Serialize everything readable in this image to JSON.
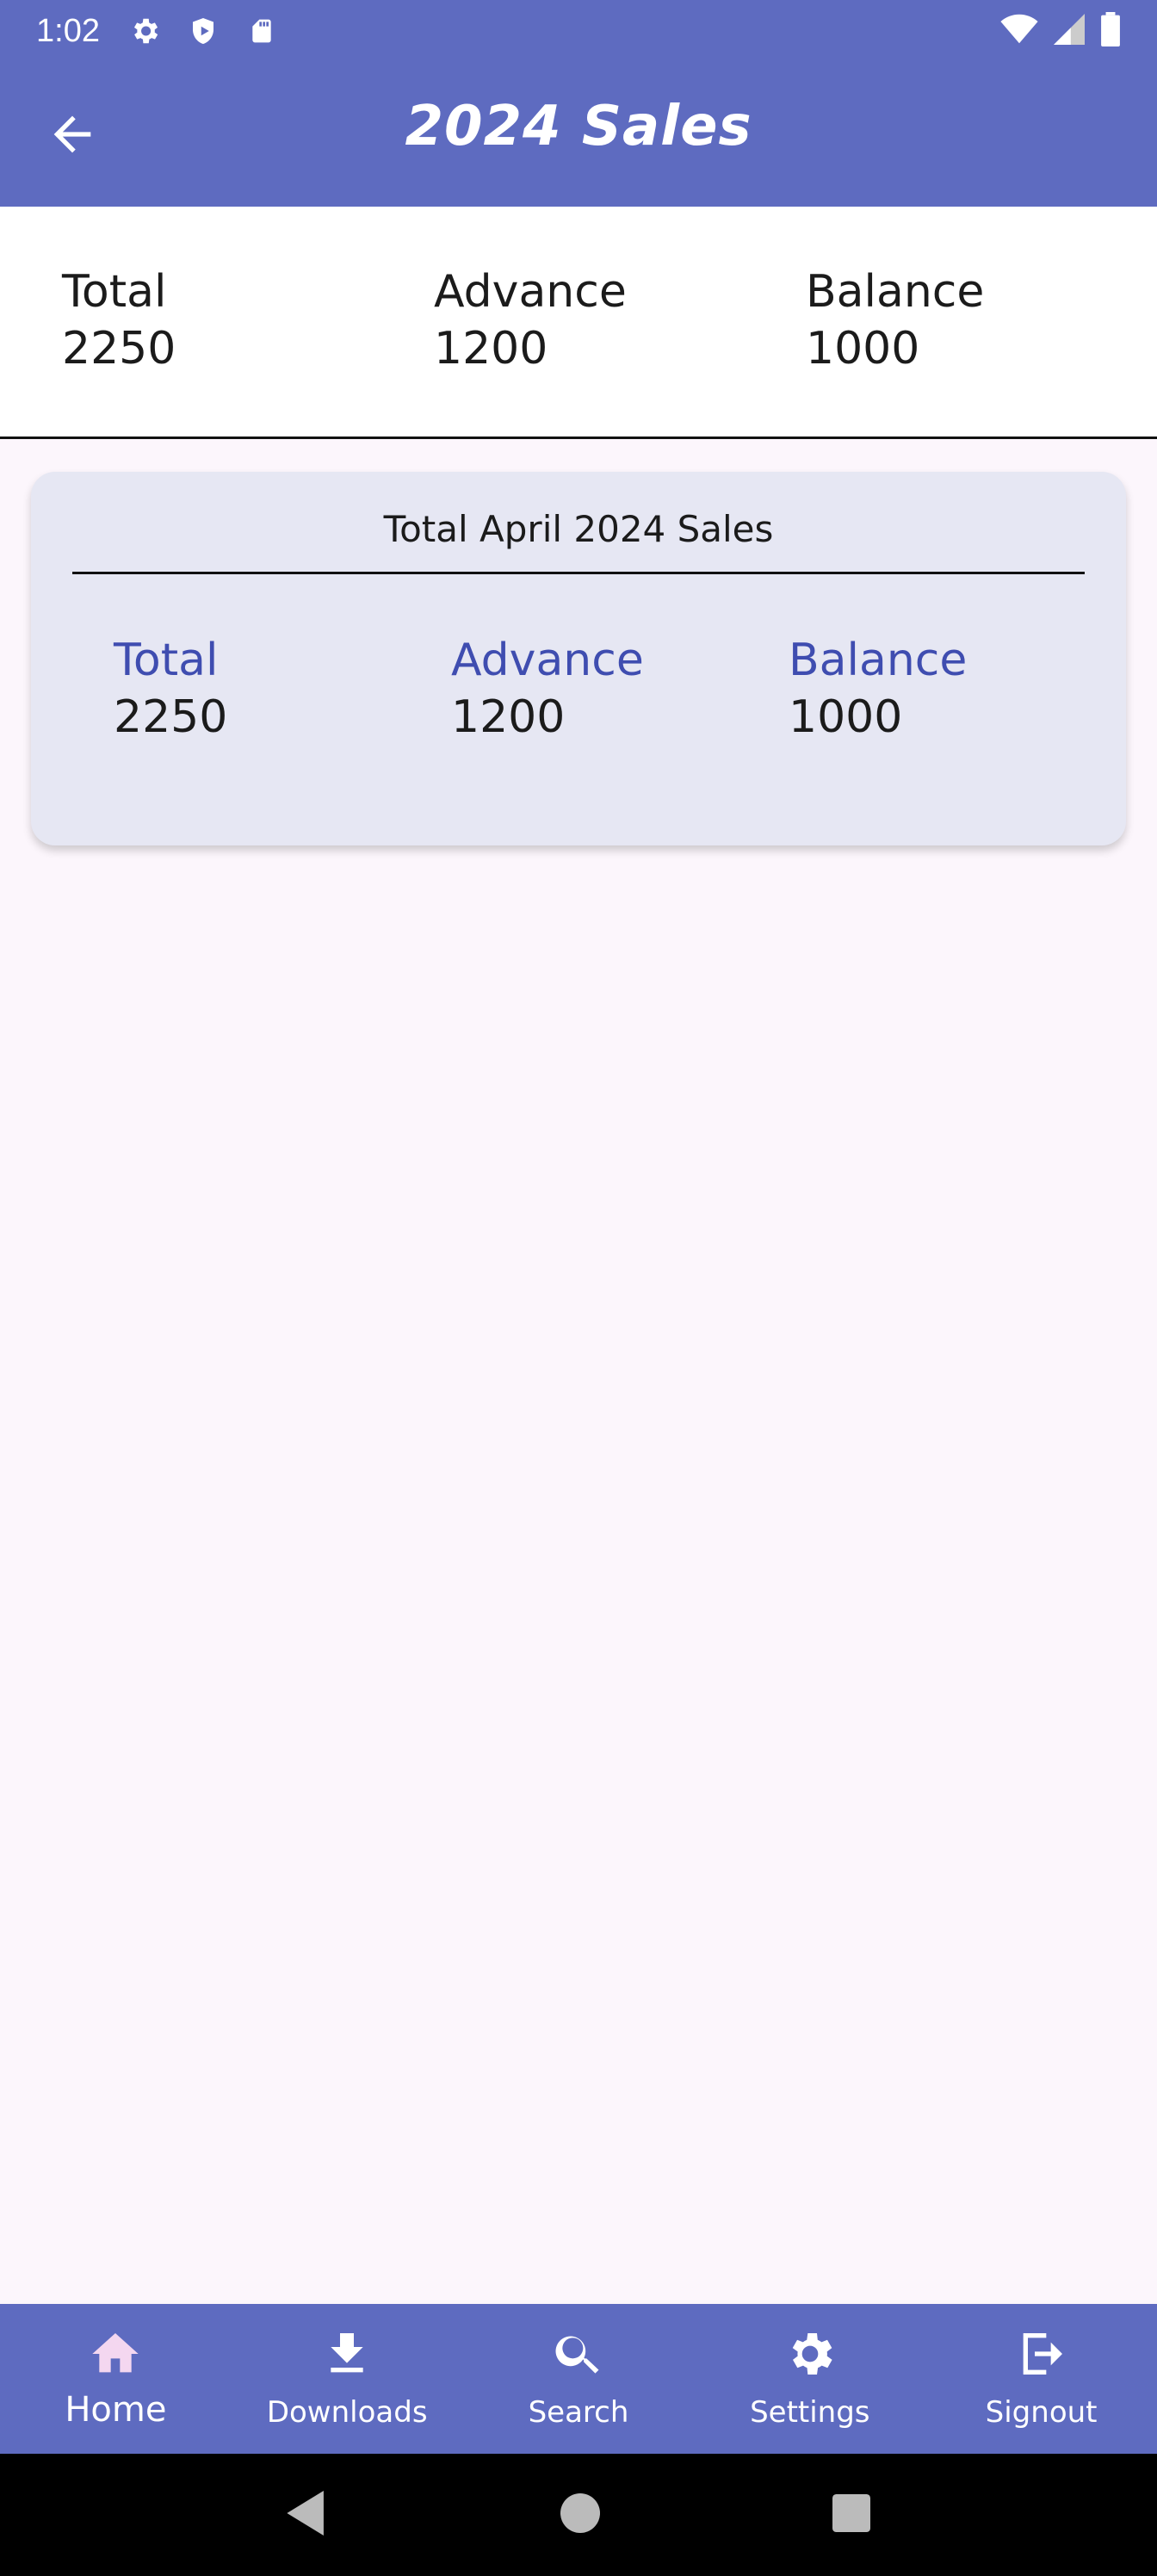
{
  "status_bar": {
    "time": "1:02",
    "icons": [
      "gear-icon",
      "shield-icon",
      "sd-card-icon",
      "wifi-icon",
      "signal-icon",
      "battery-icon"
    ]
  },
  "app_bar": {
    "title": "2024 Sales",
    "back_icon": "arrow-left-icon"
  },
  "summary": {
    "total_label": "Total",
    "total_value": "2250",
    "advance_label": "Advance",
    "advance_value": "1200",
    "balance_label": "Balance",
    "balance_value": "1000"
  },
  "month_card": {
    "title": "Total April 2024 Sales",
    "total_label": "Total",
    "total_value": "2250",
    "advance_label": "Advance",
    "advance_value": "1200",
    "balance_label": "Balance",
    "balance_value": "1000"
  },
  "bottom_nav": {
    "items": [
      {
        "label": "Home",
        "icon": "home-icon",
        "active": true
      },
      {
        "label": "Downloads",
        "icon": "download-icon"
      },
      {
        "label": "Search",
        "icon": "search-icon"
      },
      {
        "label": "Settings",
        "icon": "gear-icon"
      },
      {
        "label": "Signout",
        "icon": "logout-icon"
      }
    ]
  },
  "colors": {
    "primary": "#5e6bc0",
    "accent_label": "#3f4db0",
    "card_bg": "#e6e7f3",
    "page_bg": "#fcf6fc"
  }
}
